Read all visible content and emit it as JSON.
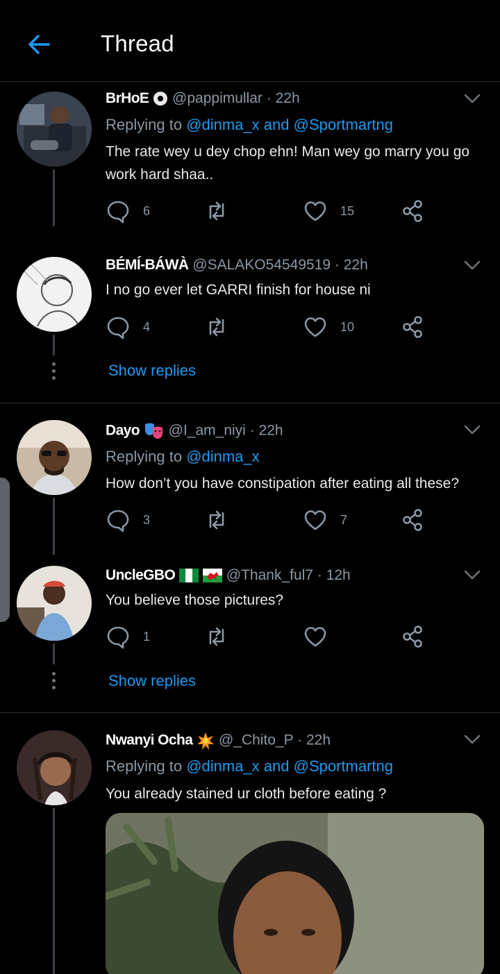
{
  "header": {
    "title": "Thread"
  },
  "tweets": [
    {
      "name": "BrHoE",
      "handle": "@pappimullar",
      "time": "22h",
      "replying_prefix": "Replying to ",
      "replying_users": "@dinma_x and @Sportmartng",
      "text": "The rate wey u dey chop ehn! Man wey go marry you go work hard shaa..",
      "replies": "6",
      "retweets": "",
      "likes": "15"
    },
    {
      "name": "BÉMÍ-BÁWÀ",
      "handle": "@SALAKO54549519",
      "time": "22h",
      "text": "I no go ever let GARRI finish for house ni",
      "replies": "4",
      "retweets": "",
      "likes": "10"
    },
    {
      "name": "Dayo",
      "handle": "@I_am_niyi",
      "time": "22h",
      "replying_prefix": "Replying to ",
      "replying_users": "@dinma_x",
      "text": "How don’t you have constipation after eating all these?",
      "replies": "3",
      "retweets": "",
      "likes": "7"
    },
    {
      "name": "UncleGBO",
      "handle": "@Thank_ful7",
      "time": "12h",
      "text": "You believe those pictures?",
      "replies": "1",
      "retweets": "",
      "likes": ""
    },
    {
      "name": "Nwanyi Ocha",
      "handle": "@_Chito_P",
      "time": "22h",
      "replying_prefix": "Replying to ",
      "replying_users": "@dinma_x and @Sportmartng",
      "text": "You already stained ur cloth before eating ?"
    }
  ],
  "show_replies": [
    "Show replies",
    "Show replies"
  ],
  "separator": "·",
  "colors": {
    "accent": "#1d9bf0",
    "muted": "#8b98a5",
    "background": "#000000",
    "divider": "#2f3336"
  },
  "icons": [
    "back-arrow-icon",
    "chevron-down-icon",
    "reply-icon",
    "retweet-icon",
    "like-icon",
    "share-icon",
    "verified-badge-icon",
    "theater-masks-icon",
    "nigeria-flag-icon",
    "wales-flag-icon",
    "sparkle-icon"
  ]
}
